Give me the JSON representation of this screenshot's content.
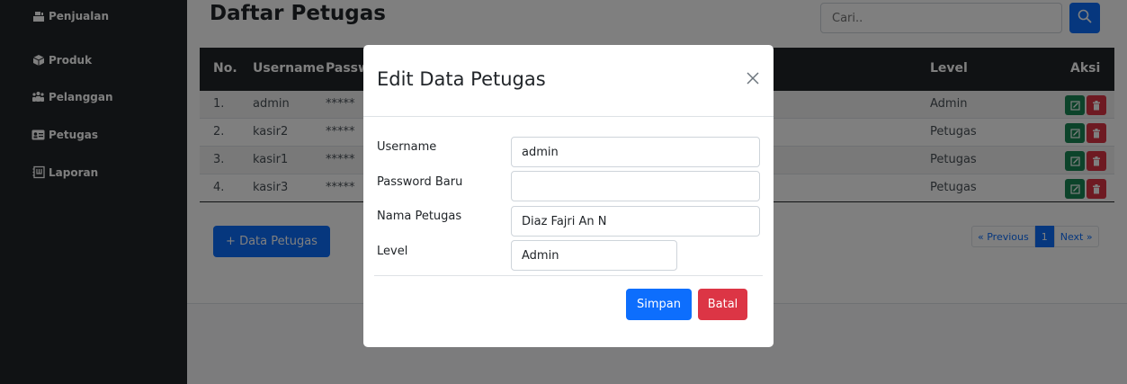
{
  "sidebar": {
    "items": [
      {
        "label": "Penjualan",
        "icon": "cash-register-icon"
      },
      {
        "label": "Produk",
        "icon": "box-icon"
      },
      {
        "label": "Pelanggan",
        "icon": "users-icon"
      },
      {
        "label": "Petugas",
        "icon": "id-card-icon"
      },
      {
        "label": "Laporan",
        "icon": "report-icon"
      }
    ]
  },
  "page": {
    "title": "Daftar Petugas",
    "search_placeholder": "Cari..",
    "search_icon": "search-icon"
  },
  "table": {
    "headers": [
      "No.",
      "Username",
      "Password",
      "Level",
      "Aksi"
    ],
    "rows": [
      {
        "no": "1.",
        "username": "admin",
        "password": "*****",
        "level": "Admin"
      },
      {
        "no": "2.",
        "username": "kasir2",
        "password": "*****",
        "level": "Petugas"
      },
      {
        "no": "3.",
        "username": "kasir1",
        "password": "*****",
        "level": "Petugas"
      },
      {
        "no": "4.",
        "username": "kasir3",
        "password": "*****",
        "level": "Petugas"
      }
    ]
  },
  "actions": {
    "add_label": "+ Data Petugas"
  },
  "pagination": {
    "prev": "« Previous",
    "current": "1",
    "next": "Next »"
  },
  "modal": {
    "title": "Edit Data Petugas",
    "fields": [
      {
        "label": "Username",
        "value": "admin"
      },
      {
        "label": "Password Baru",
        "value": ""
      },
      {
        "label": "Nama Petugas",
        "value": "Diaz Fajri An N"
      },
      {
        "label": "Level",
        "value": "Admin"
      }
    ],
    "save_label": "Simpan",
    "cancel_label": "Batal"
  },
  "colors": {
    "sidebar_bg": "#212529",
    "primary": "#0d6efd",
    "success": "#198754",
    "danger": "#dc3545"
  }
}
